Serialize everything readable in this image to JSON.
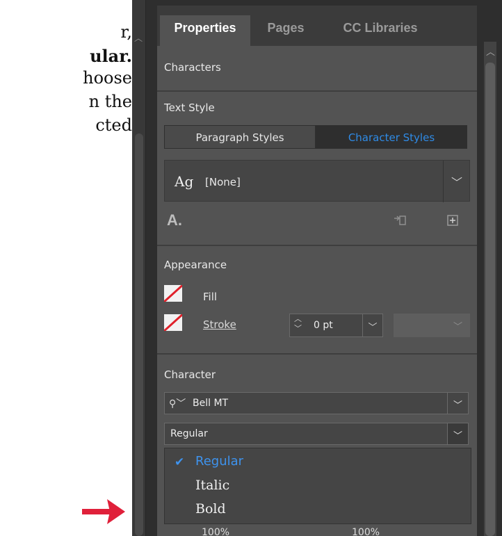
{
  "document": {
    "lines": [
      "r,",
      "ular.",
      "hoose",
      "n the",
      "cted"
    ]
  },
  "tabs": {
    "properties": "Properties",
    "pages": "Pages",
    "cc_libraries": "CC Libraries"
  },
  "panel": {
    "characters_label": "Characters",
    "text_style": {
      "heading": "Text Style",
      "paragraph_styles": "Paragraph Styles",
      "character_styles": "Character Styles",
      "current_style_preview": "Ag",
      "current_style": "[None]"
    },
    "appearance": {
      "heading": "Appearance",
      "fill_label": "Fill",
      "stroke_label": "Stroke",
      "stroke_weight": "0 pt"
    },
    "character": {
      "heading": "Character",
      "font_family": "Bell MT",
      "font_style": "Regular",
      "font_style_options": [
        "Regular",
        "Italic",
        "Bold"
      ],
      "selected_option": "Regular",
      "horizontal_scale": "100%",
      "vertical_scale": "100%"
    }
  },
  "colors": {
    "accent": "#3e93ee",
    "arrow": "#e0203a",
    "panel_bg": "#535353"
  },
  "icons": [
    "search-icon",
    "chevron-down-icon",
    "check-icon",
    "load-styles-icon",
    "new-style-icon",
    "clear-overrides-icon",
    "arrow-right-icon"
  ]
}
